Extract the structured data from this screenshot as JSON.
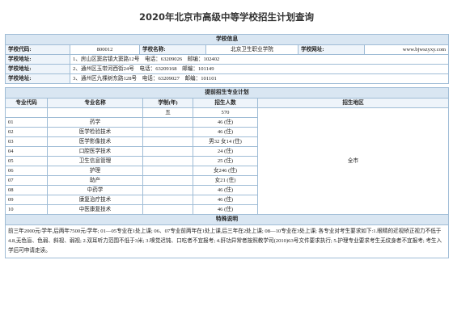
{
  "page_title": "2020年北京市高级中等学校招生计划查询",
  "school_info": {
    "section_title": "学校信息",
    "code_label": "学校代码:",
    "code_value": "800012",
    "name_label": "学校名称:",
    "name_value": "北京卫生职业学院",
    "website_label": "学校网址:",
    "website_value": "www.bjwszyxy.com",
    "address_label": "学校地址:",
    "addresses": [
      "1、房山区窦店镇大窦路12号　电话：63209026　邮编：102402",
      "2、通州区玉带河西街24号　电话：63209168　邮编：101149",
      "3、通州区九棵树东路128号　电话：63209027　邮编：101101"
    ]
  },
  "plan": {
    "section_title": "提前招生专业计划",
    "headers": [
      "专业代码",
      "专业名称",
      "学制(年)",
      "招生人数",
      "招生地区"
    ],
    "total_row": {
      "years": "五",
      "count": "570"
    },
    "rows": [
      {
        "code": "01",
        "name": "药学",
        "count": "46 (住)"
      },
      {
        "code": "02",
        "name": "医学检验技术",
        "count": "46 (住)"
      },
      {
        "code": "03",
        "name": "医学影像技术",
        "count": "男32 女14 (住)"
      },
      {
        "code": "04",
        "name": "口腔医学技术",
        "count": "24 (住)"
      },
      {
        "code": "05",
        "name": "卫生信息管理",
        "count": "25 (住)"
      },
      {
        "code": "06",
        "name": "护理",
        "count": "女246 (住)"
      },
      {
        "code": "07",
        "name": "助产",
        "count": "女21 (住)"
      },
      {
        "code": "08",
        "name": "中药学",
        "count": "46 (住)"
      },
      {
        "code": "09",
        "name": "康复治疗技术",
        "count": "46 (住)"
      },
      {
        "code": "10",
        "name": "中医康复技术",
        "count": "46 (住)"
      }
    ],
    "region": "全市"
  },
  "notes": {
    "section_title": "特殊说明",
    "text": "前三年2000元/学年,后两年7500元/学年; 01—05专业在1处上课; 06、07专业前两年在1处上课,后三年在2处上课; 08—10专业在3处上课; 各专业对考生要求如下:1.眼睛的近视矫正视力不低于4.8,无色盲、色弱、斜视、弱视; 2.双耳听力范围不低于3米; 3.嗅觉迟钝、口吃者不宜报考; 4.肝功异常者按照教学司(2010)63号文件要求执行; 5.护理专业要求考生无纹身者不宜报考; 考生入学后可申请走读。"
  }
}
